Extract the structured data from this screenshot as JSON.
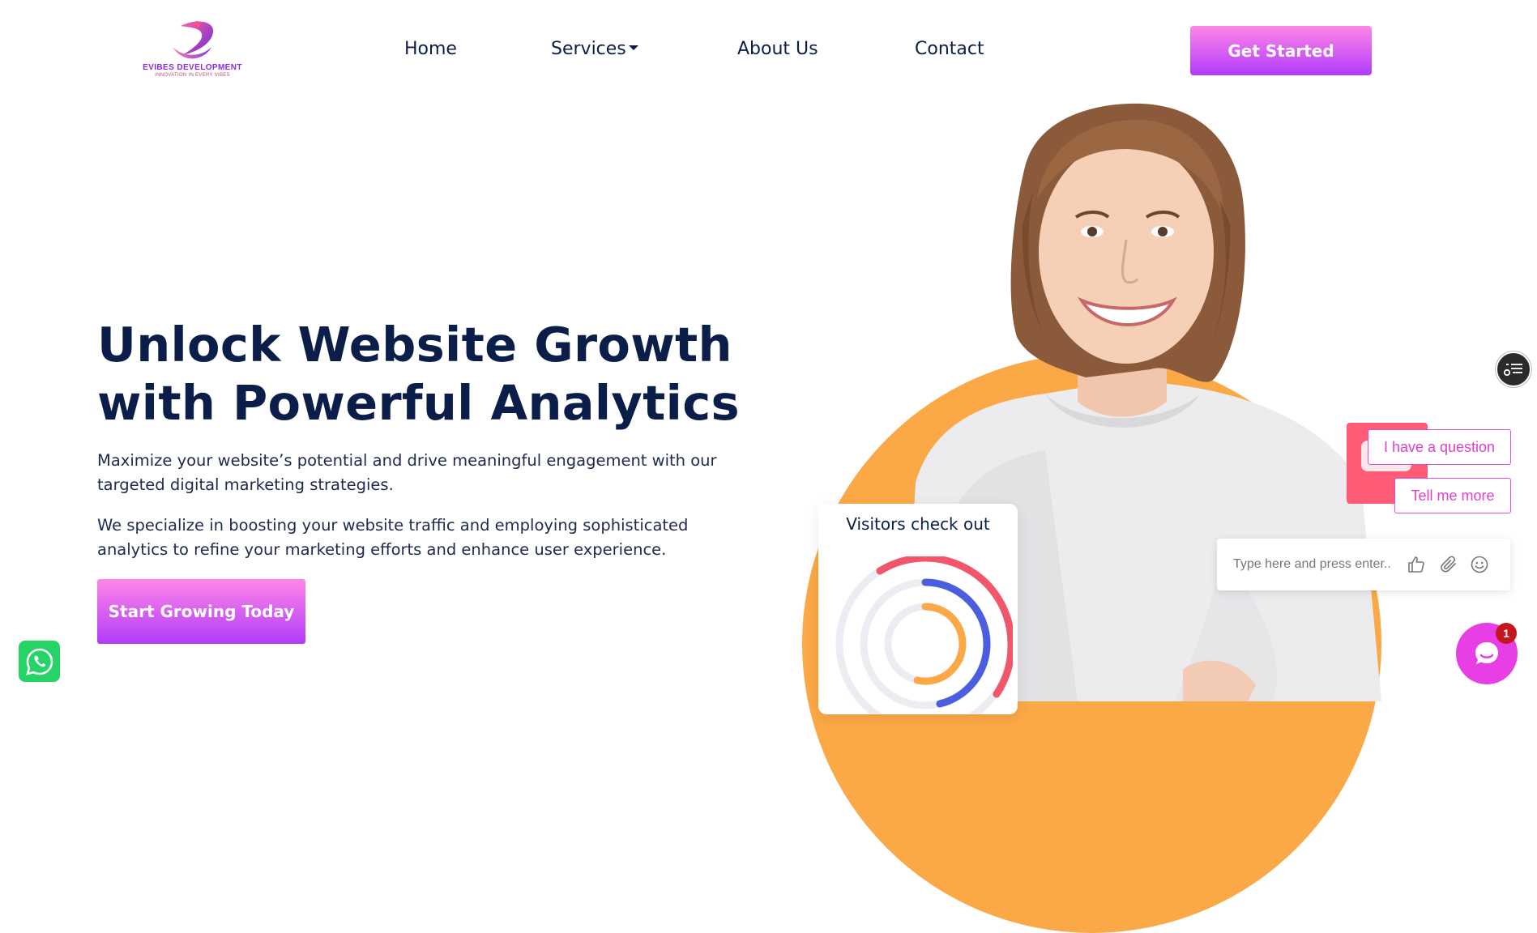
{
  "header": {
    "logo": {
      "name": "EVIBES DEVELOPMENT",
      "tagline": "INNOVATION IN EVERY VIBES"
    },
    "nav": [
      {
        "label": "Home"
      },
      {
        "label": "Services",
        "has_dropdown": true
      },
      {
        "label": "About Us"
      },
      {
        "label": "Contact"
      }
    ],
    "cta_label": "Get Started"
  },
  "hero": {
    "title_line1": "Unlock Website Growth",
    "title_line2": "with Powerful Analytics",
    "paragraph1": "Maximize your website’s potential and drive meaningful engagement with our targeted digital marketing strategies.",
    "paragraph2": "We specialize in boosting your website traffic and employing sophisticated analytics to refine your marketing efforts and enhance user experience.",
    "cta_label": "Start Growing Today"
  },
  "visitors_card": {
    "title": "Visitors check out"
  },
  "chat_widget": {
    "quick_replies": [
      "I have a question",
      "Tell me more"
    ],
    "input_placeholder": "Type here and press enter..",
    "unread_count": "1"
  },
  "colors": {
    "brand_gradient_top": "#ff86e6",
    "brand_gradient_bottom": "#b13cfb",
    "heading": "#0b1e4a",
    "orange_accent": "#fba846",
    "chat_pink": "#e83ee6",
    "whatsapp_green": "#25d366"
  }
}
